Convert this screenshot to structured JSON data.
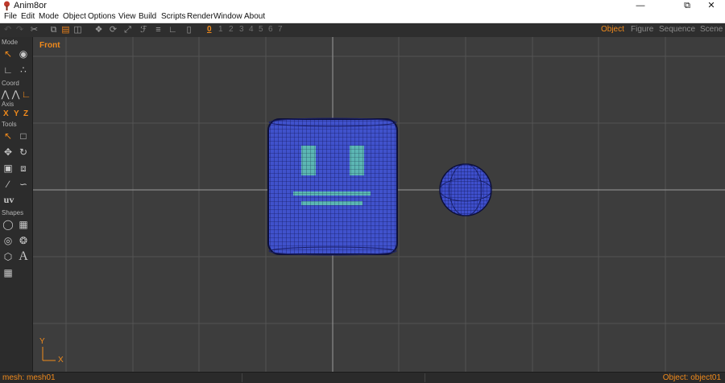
{
  "window": {
    "title": "Anim8or"
  },
  "menu": [
    "File",
    "Edit",
    "Mode",
    "Object",
    "Options",
    "View",
    "Build",
    "Scripts",
    "Render",
    "Window",
    "About"
  ],
  "toolbar": {
    "digits": [
      "0",
      "1",
      "2",
      "3",
      "4",
      "5",
      "6",
      "7"
    ],
    "active_digit": "0",
    "view_tabs": [
      "Object",
      "Figure",
      "Sequence",
      "Scene"
    ],
    "active_tab": "Object"
  },
  "left_panel": {
    "mode_label": "Mode",
    "coord_label": "Coord",
    "axis_label": "Axis",
    "axis_buttons": [
      "X",
      "Y",
      "Z"
    ],
    "tools_label": "Tools",
    "uv_label": "uv",
    "shapes_label": "Shapes",
    "text_tool": "A"
  },
  "viewport": {
    "view_name": "Front",
    "axis_y": "Y",
    "axis_x": "X"
  },
  "status": {
    "left": "mesh: mesh01",
    "right": "Object: object01"
  },
  "colors": {
    "accent": "#f08a1c",
    "mesh_blue": "#3f4fc8",
    "mesh_highlight": "#5ab4b4",
    "viewport_bg": "#3d3d3d"
  }
}
